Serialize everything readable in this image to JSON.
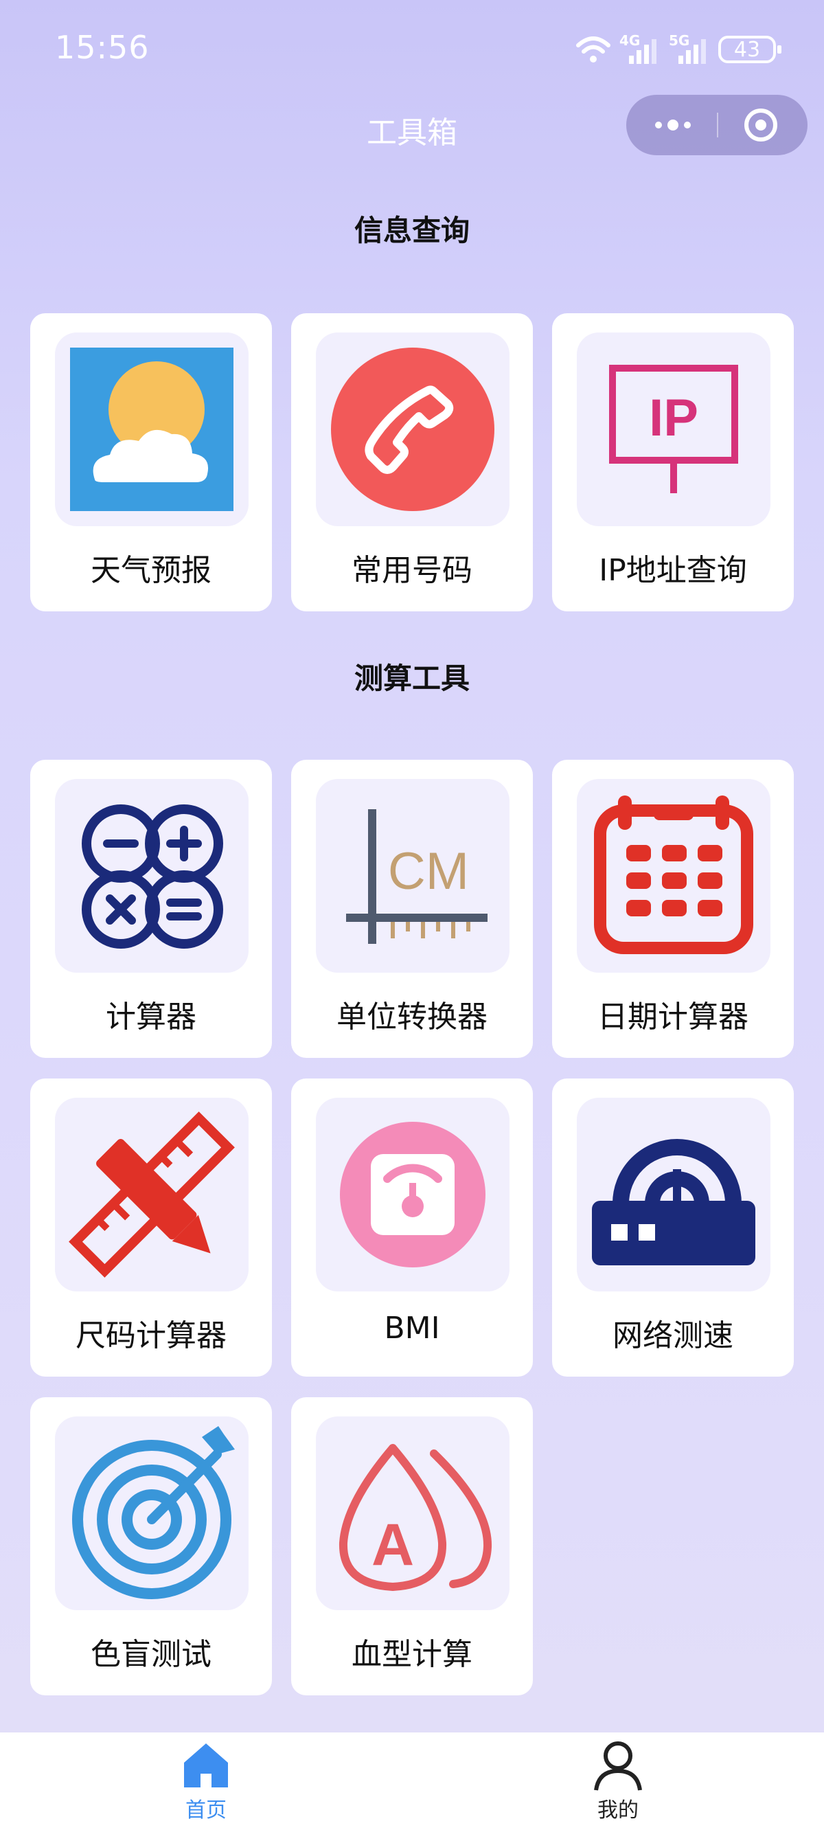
{
  "status_bar": {
    "time": "15:56",
    "battery": "43",
    "network_1": "4G",
    "network_2": "5G"
  },
  "nav": {
    "title": "工具箱"
  },
  "sections": [
    {
      "title": "信息查询",
      "items": [
        {
          "label": "天气预报",
          "icon": "weather-icon"
        },
        {
          "label": "常用号码",
          "icon": "phone-icon"
        },
        {
          "label": "IP地址查询",
          "icon": "ip-sign-icon",
          "icon_text": "IP"
        }
      ]
    },
    {
      "title": "测算工具",
      "items": [
        {
          "label": "计算器",
          "icon": "calculator-icon"
        },
        {
          "label": "单位转换器",
          "icon": "ruler-cm-icon",
          "icon_text": "CM"
        },
        {
          "label": "日期计算器",
          "icon": "calendar-icon"
        },
        {
          "label": "尺码计算器",
          "icon": "pencil-ruler-icon"
        },
        {
          "label": "BMI",
          "icon": "scale-icon"
        },
        {
          "label": "网络测速",
          "icon": "router-icon"
        },
        {
          "label": "色盲测试",
          "icon": "target-icon"
        },
        {
          "label": "血型计算",
          "icon": "blood-drop-icon",
          "icon_text": "A"
        }
      ]
    }
  ],
  "tabbar": {
    "tabs": [
      {
        "label": "首页",
        "icon": "home-icon",
        "active": true
      },
      {
        "label": "我的",
        "icon": "user-icon",
        "active": false
      }
    ],
    "active_color": "#3d8ef0",
    "inactive_color": "#222222"
  }
}
